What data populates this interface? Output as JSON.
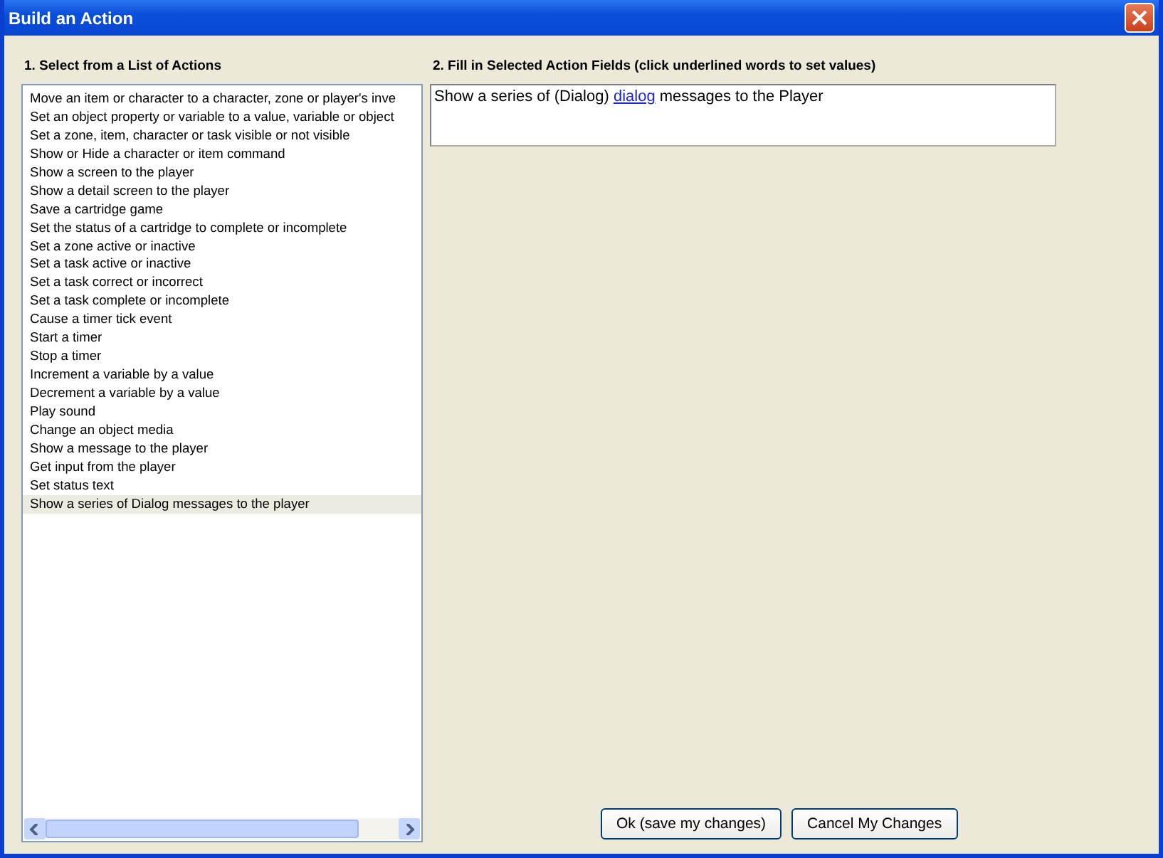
{
  "window": {
    "title": "Build an Action"
  },
  "actions_list": {
    "heading": "1. Select from a List of Actions",
    "items": [
      {
        "label": "Move an item or character to a character, zone or player's inve",
        "selected": false
      },
      {
        "label": "Set an object property or variable to a value, variable or object",
        "selected": false
      },
      {
        "label": "Set a zone, item, character or task visible or not visible",
        "selected": false
      },
      {
        "label": "Show or Hide a character or item command",
        "selected": false
      },
      {
        "label": "Show a screen to the player",
        "selected": false
      },
      {
        "label": "Show a detail screen to the player",
        "selected": false
      },
      {
        "label": "Save a cartridge game",
        "selected": false
      },
      {
        "label": "Set the status of a cartridge to complete or incomplete",
        "selected": false
      },
      {
        "label": "Set a zone active or inactive",
        "selected": false
      },
      {
        "label": "Set a task active or inactive",
        "selected": false
      },
      {
        "label": "Set a task correct or incorrect",
        "selected": false
      },
      {
        "label": "Set a task complete or incomplete",
        "selected": false
      },
      {
        "label": "Cause a timer tick event",
        "selected": false
      },
      {
        "label": "Start a timer",
        "selected": false
      },
      {
        "label": "Stop a timer",
        "selected": false
      },
      {
        "label": "Increment a variable by a value",
        "selected": false
      },
      {
        "label": "Decrement a variable by a value",
        "selected": false
      },
      {
        "label": "Play sound",
        "selected": false
      },
      {
        "label": "Change an object media",
        "selected": false
      },
      {
        "label": "Show a message to the player",
        "selected": false
      },
      {
        "label": "Get input from the player",
        "selected": false
      },
      {
        "label": "Set status text",
        "selected": false
      },
      {
        "label": "Show a series of Dialog messages to the player",
        "selected": true
      }
    ]
  },
  "fields": {
    "heading": "2. Fill in Selected Action Fields (click underlined words to set values)",
    "segments": [
      {
        "kind": "plain",
        "text": "Show a series of (Dialog) "
      },
      {
        "kind": "link",
        "text": "dialog"
      },
      {
        "kind": "plain",
        "text": " messages to the Player"
      }
    ]
  },
  "buttons": [
    "Ok (save my changes)",
    "Cancel My Changes"
  ]
}
